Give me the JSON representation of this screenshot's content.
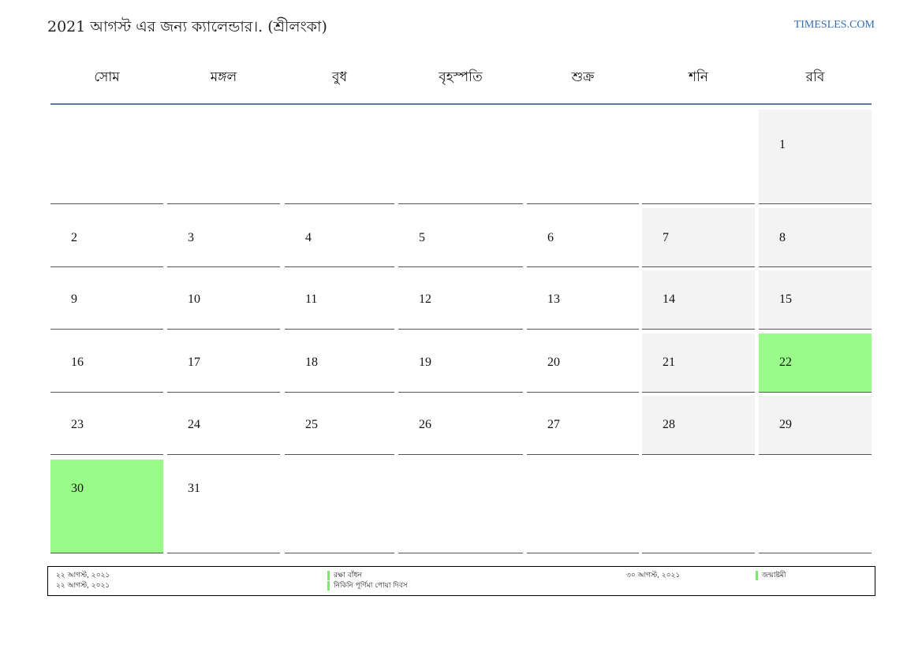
{
  "title": "2021 আগস্ট এর জন্য ক্যালেন্ডার।. (শ্রীলংকা)",
  "brand": "TIMESLES.COM",
  "weekdays": [
    "সোম",
    "মঙ্গল",
    "বুধ",
    "বৃহস্পতি",
    "শুক্র",
    "শনি",
    "রবি"
  ],
  "weeks": [
    [
      "",
      "",
      "",
      "",
      "",
      "",
      "1"
    ],
    [
      "2",
      "3",
      "4",
      "5",
      "6",
      "7",
      "8"
    ],
    [
      "9",
      "10",
      "11",
      "12",
      "13",
      "14",
      "15"
    ],
    [
      "16",
      "17",
      "18",
      "19",
      "20",
      "21",
      "22"
    ],
    [
      "23",
      "24",
      "25",
      "26",
      "27",
      "28",
      "29"
    ],
    [
      "30",
      "31",
      "",
      "",
      "",
      "",
      ""
    ]
  ],
  "holiday_days": [
    "22",
    "30"
  ],
  "colors": {
    "holiday": "#9afc88",
    "weekend": "#f3f3f3",
    "header_rule": "#5b7a9d",
    "brand": "#2f6fb5"
  },
  "legend": {
    "left_dates": [
      "২২ আগস্ট, ২০২১",
      "২২ আগস্ট, ২০২১"
    ],
    "left_names": [
      "রক্ষা বাঁধন",
      "নিকিনি পূর্ণিমা পোয়া দিবস"
    ],
    "right_dates": [
      "৩০ আগস্ট, ২০২১"
    ],
    "right_names": [
      "জন্মাষ্টমী"
    ]
  }
}
